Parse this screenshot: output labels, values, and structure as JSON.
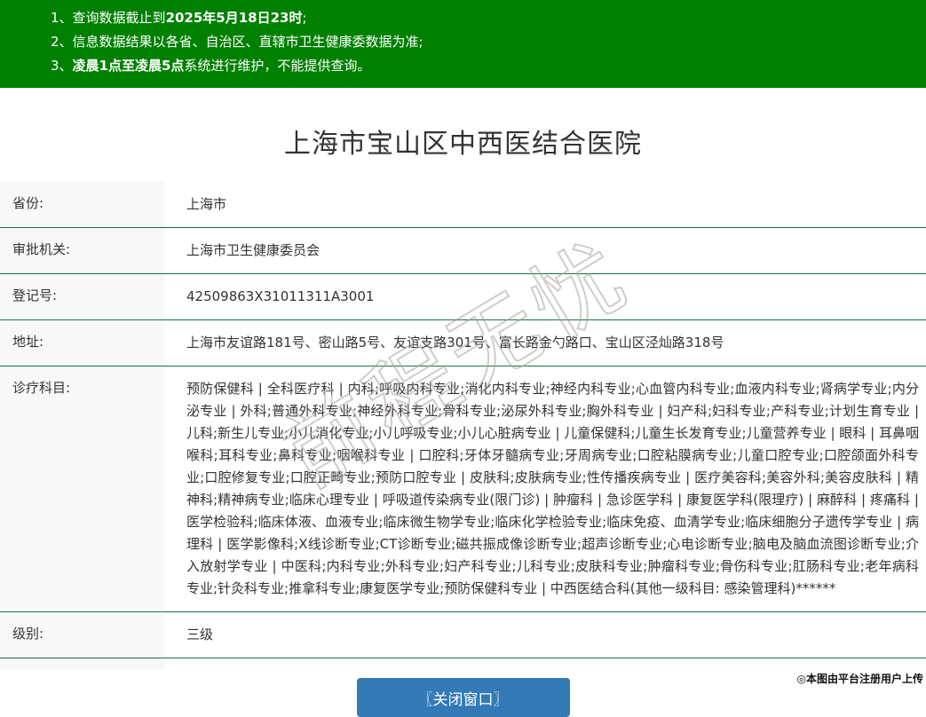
{
  "banner": {
    "bg_color": "#008000",
    "notices": [
      {
        "num": "1、",
        "pre": "查询数据截止到",
        "bold": "2025年5月18日23时",
        "post": ";"
      },
      {
        "num": "2、",
        "pre": "信息数据结果以各省、自治区、直辖市卫生健康委数据为准;",
        "bold": "",
        "post": ""
      },
      {
        "num": "3、",
        "pre": "",
        "bold": "凌晨1点至凌晨5点",
        "post": "系统进行维护，不能提供查询。"
      }
    ]
  },
  "hospital": {
    "title": "上海市宝山区中西医结合医院"
  },
  "table": {
    "rows": [
      {
        "label": "省份:",
        "value": "上海市"
      },
      {
        "label": "审批机关:",
        "value": "上海市卫生健康委员会"
      },
      {
        "label": "登记号:",
        "value": "42509863X31011311A3001"
      },
      {
        "label": "地址:",
        "value": "上海市友谊路181号、密山路5号、友谊支路301号、富长路金勺路口、宝山区泾灿路318号"
      },
      {
        "label": "诊疗科目:",
        "value": "预防保健科 | 全科医疗科 | 内科;呼吸内科专业;消化内科专业;神经内科专业;心血管内科专业;血液内科专业;肾病学专业;内分泌专业 | 外科;普通外科专业;神经外科专业;骨科专业;泌尿外科专业;胸外科专业 | 妇产科;妇科专业;产科专业;计划生育专业 | 儿科;新生儿专业;小儿消化专业;小儿呼吸专业;小儿心脏病专业 | 儿童保健科;儿童生长发育专业;儿童营养专业 | 眼科 | 耳鼻咽喉科;耳科专业;鼻科专业;咽喉科专业 | 口腔科;牙体牙髓病专业;牙周病专业;口腔粘膜病专业;儿童口腔专业;口腔颌面外科专业;口腔修复专业;口腔正畸专业;预防口腔专业 | 皮肤科;皮肤病专业;性传播疾病专业 | 医疗美容科;美容外科;美容皮肤科 | 精神科;精神病专业;临床心理专业 | 呼吸道传染病专业(限门诊) | 肿瘤科 | 急诊医学科 | 康复医学科(限理疗) | 麻醉科 | 疼痛科 | 医学检验科;临床体液、血液专业;临床微生物学专业;临床化学检验专业;临床免疫、血清学专业;临床细胞分子遗传学专业 | 病理科 | 医学影像科;X线诊断专业;CT诊断专业;磁共振成像诊断专业;超声诊断专业;心电诊断专业;脑电及脑血流图诊断专业;介入放射学专业 | 中医科;内科专业;外科专业;妇产科专业;儿科专业;皮肤科专业;肿瘤科专业;骨伤科专业;肛肠科专业;老年病科专业;针灸科专业;推拿科专业;康复医学专业;预防保健科专业 | 中西医结合科(其他一级科目: 感染管理科)******"
      },
      {
        "label": "级别:",
        "value": "三级"
      }
    ]
  },
  "footer": {
    "close_button_label": "〖关闭窗口〗",
    "upload_note": "◎本图由平台注册用户上传"
  },
  "watermark": {
    "text": "前程无忧"
  },
  "colors": {
    "banner_green": "#008000",
    "row_border_green": "#157347",
    "button_blue": "#337ab7",
    "label_bg": "#f8f8f8"
  }
}
